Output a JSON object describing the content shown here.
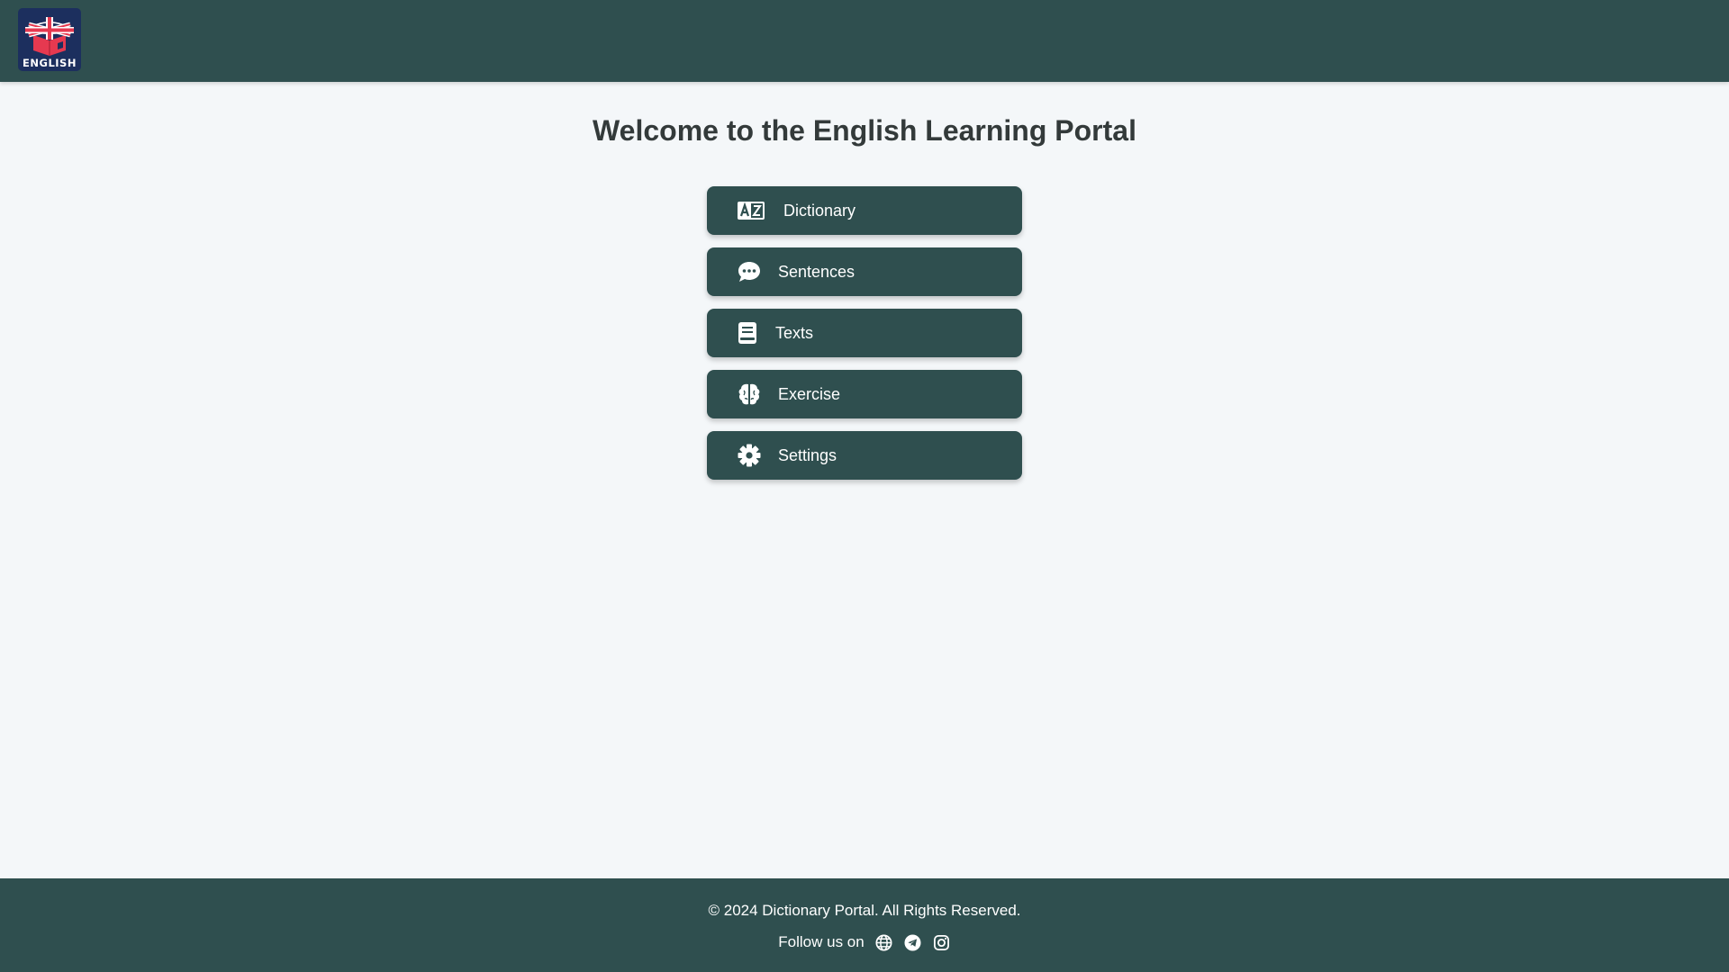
{
  "header": {
    "logo_text": "ENGLISH"
  },
  "main": {
    "title": "Welcome to the English Learning Portal",
    "menu": [
      {
        "label": "Dictionary",
        "icon": "language-az-icon"
      },
      {
        "label": "Sentences",
        "icon": "chat-bubble-icon"
      },
      {
        "label": "Texts",
        "icon": "book-icon"
      },
      {
        "label": "Exercise",
        "icon": "brain-icon"
      },
      {
        "label": "Settings",
        "icon": "gear-icon"
      }
    ]
  },
  "footer": {
    "copyright": "© 2024 Dictionary Portal. All Rights Reserved.",
    "follow_label": "Follow us on",
    "social": [
      "globe-icon",
      "telegram-icon",
      "instagram-icon"
    ]
  },
  "colors": {
    "primary": "#2f4f4f",
    "background": "#f4f7f9",
    "logo_bg": "#1c2f5e",
    "logo_red": "#e63950"
  }
}
